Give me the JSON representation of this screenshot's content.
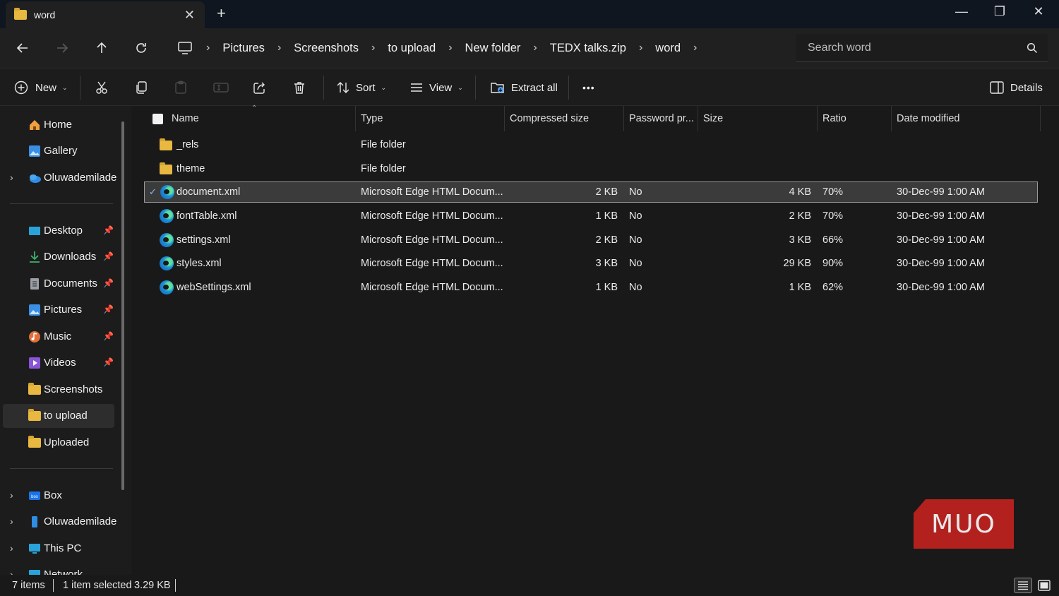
{
  "window": {
    "tab_title": "word",
    "tab_close": "✕",
    "new_tab": "+",
    "minimize": "—",
    "maximize": "❐",
    "close": "✕"
  },
  "nav": {
    "back": "←",
    "forward": "→",
    "up": "↑",
    "refresh": "↻",
    "breadcrumbs": [
      "Pictures",
      "Screenshots",
      "to upload",
      "New folder",
      "TEDX talks.zip",
      "word"
    ],
    "search_placeholder": "Search word"
  },
  "toolbar": {
    "new_label": "New",
    "sort_label": "Sort",
    "view_label": "View",
    "extract_label": "Extract all",
    "more_label": "•••",
    "details_label": "Details"
  },
  "sidebar": {
    "items": [
      {
        "label": "Home",
        "icon": "home-icon",
        "color": "#f0a040"
      },
      {
        "label": "Gallery",
        "icon": "gallery-icon",
        "color": "#3a8ee6"
      },
      {
        "label": "Oluwademilade",
        "icon": "onedrive-icon",
        "color": "#2f8de4"
      },
      {
        "label": "Desktop",
        "icon": "desktop-icon",
        "color": "#2aa4d8"
      },
      {
        "label": "Downloads",
        "icon": "download-icon",
        "color": "#3db36b"
      },
      {
        "label": "Documents",
        "icon": "documents-icon",
        "color": "#9aa0a6"
      },
      {
        "label": "Pictures",
        "icon": "pictures-icon",
        "color": "#3a8ee6"
      },
      {
        "label": "Music",
        "icon": "music-icon",
        "color": "#e0703a"
      },
      {
        "label": "Videos",
        "icon": "videos-icon",
        "color": "#8a55d8"
      },
      {
        "label": "Screenshots",
        "icon": "folder-icon",
        "color": "#e8b840"
      },
      {
        "label": "to upload",
        "icon": "folder-icon",
        "color": "#e8b840"
      },
      {
        "label": "Uploaded",
        "icon": "folder-icon",
        "color": "#e8b840"
      },
      {
        "label": "Box",
        "icon": "box-icon",
        "color": "#1a73e8"
      },
      {
        "label": "Oluwademilade",
        "icon": "phone-icon",
        "color": "#2f8de4"
      },
      {
        "label": "This PC",
        "icon": "pc-icon",
        "color": "#2aa4d8"
      },
      {
        "label": "Network",
        "icon": "network-icon",
        "color": "#2aa4d8"
      }
    ]
  },
  "columns": {
    "name": "Name",
    "type": "Type",
    "compressed": "Compressed size",
    "password": "Password pr...",
    "size": "Size",
    "ratio": "Ratio",
    "date": "Date modified"
  },
  "files": [
    {
      "name": "_rels",
      "type": "File folder",
      "compressed": "",
      "password": "",
      "size": "",
      "ratio": "",
      "date": "",
      "icon": "folder-icon"
    },
    {
      "name": "theme",
      "type": "File folder",
      "compressed": "",
      "password": "",
      "size": "",
      "ratio": "",
      "date": "",
      "icon": "folder-icon"
    },
    {
      "name": "document.xml",
      "type": "Microsoft Edge HTML Docum...",
      "compressed": "2 KB",
      "password": "No",
      "size": "4 KB",
      "ratio": "70%",
      "date": "30-Dec-99 1:00 AM",
      "icon": "edge-icon",
      "selected": true
    },
    {
      "name": "fontTable.xml",
      "type": "Microsoft Edge HTML Docum...",
      "compressed": "1 KB",
      "password": "No",
      "size": "2 KB",
      "ratio": "70%",
      "date": "30-Dec-99 1:00 AM",
      "icon": "edge-icon"
    },
    {
      "name": "settings.xml",
      "type": "Microsoft Edge HTML Docum...",
      "compressed": "2 KB",
      "password": "No",
      "size": "3 KB",
      "ratio": "66%",
      "date": "30-Dec-99 1:00 AM",
      "icon": "edge-icon"
    },
    {
      "name": "styles.xml",
      "type": "Microsoft Edge HTML Docum...",
      "compressed": "3 KB",
      "password": "No",
      "size": "29 KB",
      "ratio": "90%",
      "date": "30-Dec-99 1:00 AM",
      "icon": "edge-icon"
    },
    {
      "name": "webSettings.xml",
      "type": "Microsoft Edge HTML Docum...",
      "compressed": "1 KB",
      "password": "No",
      "size": "1 KB",
      "ratio": "62%",
      "date": "30-Dec-99 1:00 AM",
      "icon": "edge-icon"
    }
  ],
  "status": {
    "items": "7 items",
    "selected": "1 item selected",
    "selected_size": "3.29 KB"
  },
  "watermark": "MUO",
  "colors": {
    "accent": "#4c9ffe",
    "selected_row": "#3b3b3b",
    "watermark": "#b3211f"
  }
}
